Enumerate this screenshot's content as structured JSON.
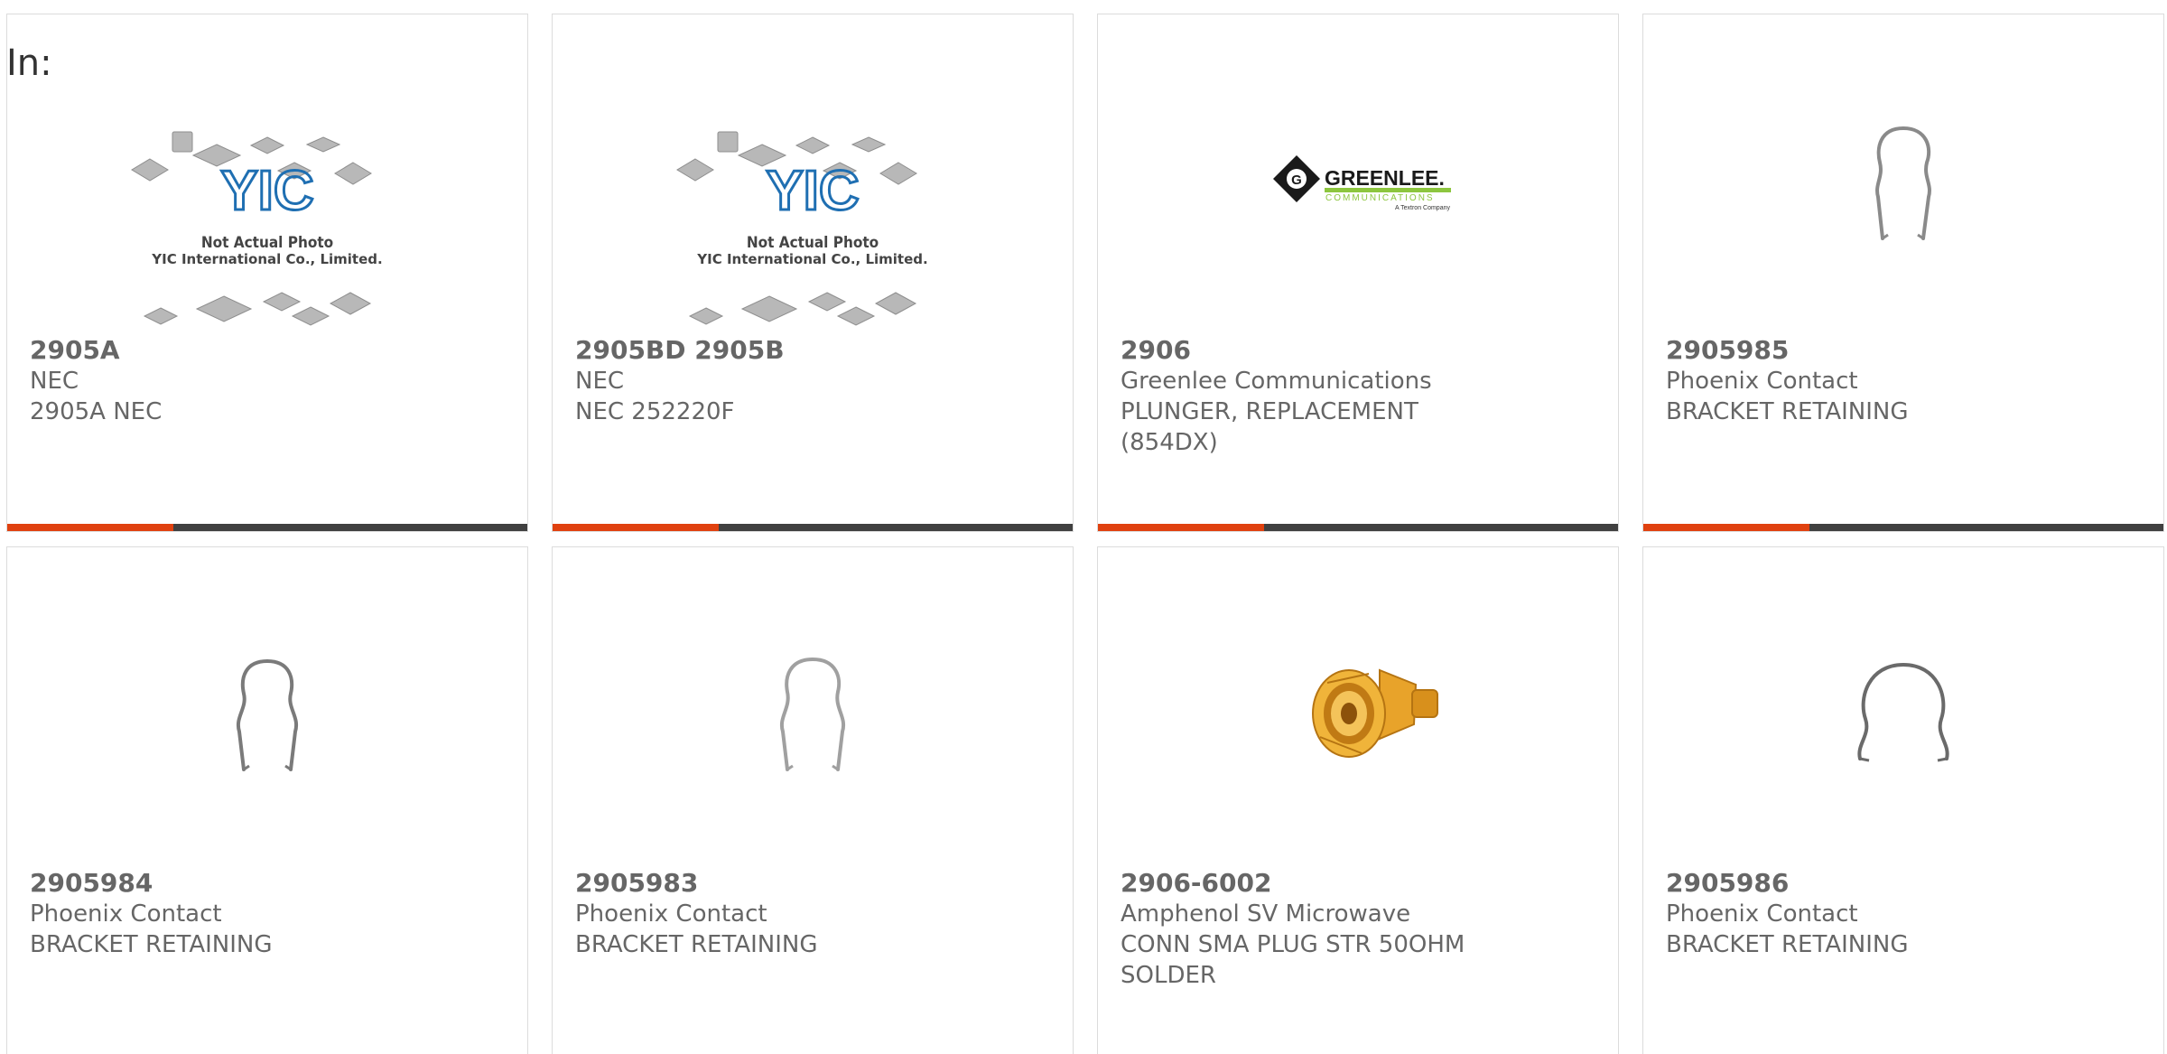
{
  "filter": {
    "label": "In:"
  },
  "colors": {
    "accent": "#e0410f",
    "bar_track": "#404040",
    "text": "#666666",
    "card_border": "#dcdcdc"
  },
  "products": [
    {
      "part": "2905A",
      "maker": "NEC",
      "desc": "2905A NEC",
      "image": "yic-placeholder",
      "watermark": {
        "line1": "Not Actual Photo",
        "line2": "YIC International Co., Limited."
      },
      "progress": 0.32
    },
    {
      "part": "2905BD 2905B",
      "maker": "NEC",
      "desc": "NEC 252220F",
      "image": "yic-placeholder",
      "watermark": {
        "line1": "Not Actual Photo",
        "line2": "YIC International Co., Limited."
      },
      "progress": 0.32
    },
    {
      "part": "2906",
      "maker": "Greenlee Communications",
      "desc": "PLUNGER, REPLACEMENT (854DX)",
      "image": "greenlee-logo",
      "logo": {
        "brand": "GREENLEE.",
        "sub": "COMMUNICATIONS",
        "tag": "A Textron Company"
      },
      "progress": 0.32
    },
    {
      "part": "2905985",
      "maker": "Phoenix Contact",
      "desc": "BRACKET RETAINING",
      "image": "wire-bracket",
      "progress": 0.32
    },
    {
      "part": "2905984",
      "maker": "Phoenix Contact",
      "desc": "BRACKET RETAINING",
      "image": "wire-bracket"
    },
    {
      "part": "2905983",
      "maker": "Phoenix Contact",
      "desc": "BRACKET RETAINING",
      "image": "wire-bracket"
    },
    {
      "part": "2906-6002",
      "maker": "Amphenol SV Microwave",
      "desc": "CONN SMA PLUG STR 50OHM SOLDER",
      "image": "sma-connector"
    },
    {
      "part": "2905986",
      "maker": "Phoenix Contact",
      "desc": "BRACKET RETAINING",
      "image": "wire-bracket"
    }
  ]
}
